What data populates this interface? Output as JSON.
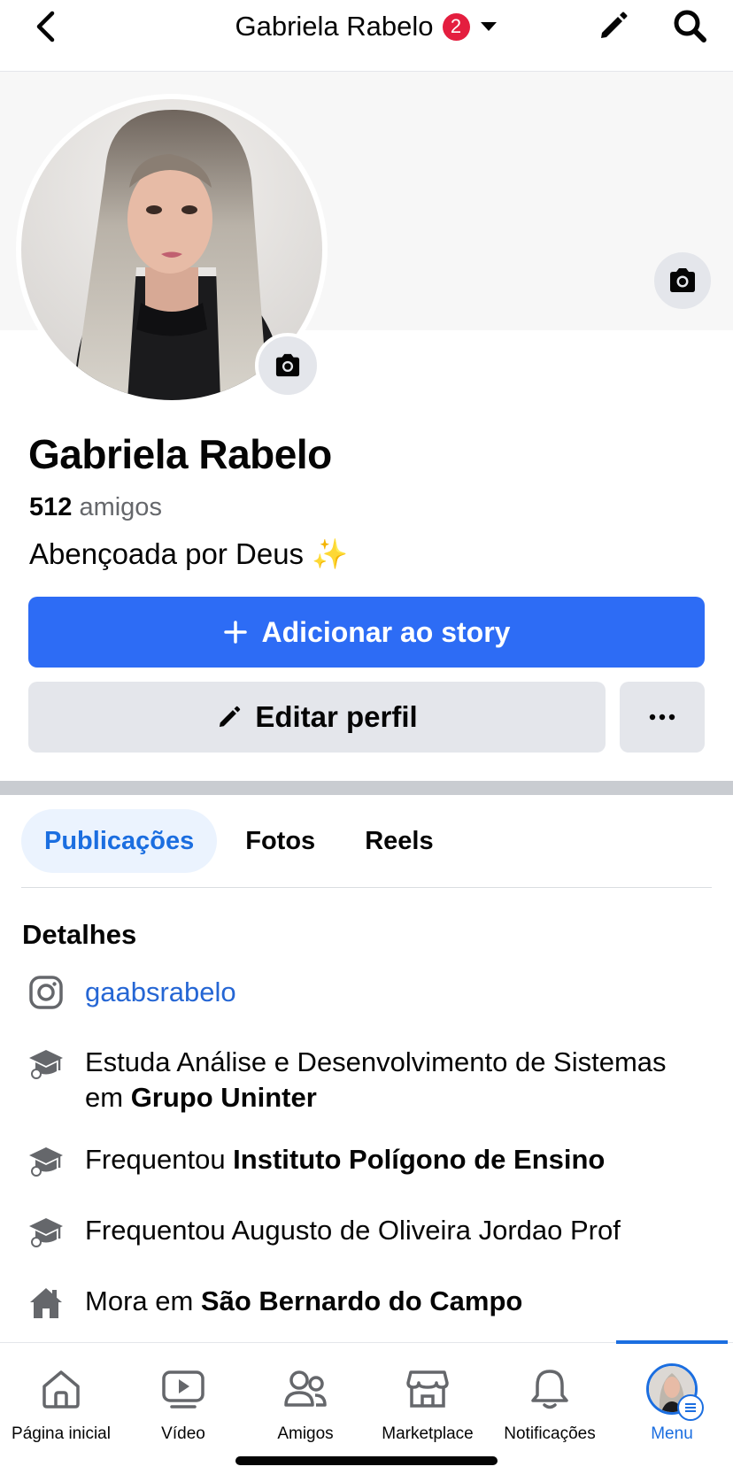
{
  "header": {
    "title": "Gabriela Rabelo",
    "badge_count": "2"
  },
  "profile": {
    "name": "Gabriela Rabelo",
    "friends_count": "512",
    "friends_label": "amigos",
    "bio": "Abençoada por Deus ✨"
  },
  "actions": {
    "story_label": "Adicionar ao story",
    "edit_label": "Editar perfil"
  },
  "tabs": [
    {
      "label": "Publicações",
      "active": true
    },
    {
      "label": "Fotos",
      "active": false
    },
    {
      "label": "Reels",
      "active": false
    }
  ],
  "details": {
    "title": "Detalhes",
    "instagram": "gaabsrabelo",
    "items": [
      {
        "prefix": "Estuda Análise e Desenvolvimento de Sistemas em ",
        "bold": "Grupo Uninter",
        "icon": "graduation-cap-icon"
      },
      {
        "prefix": "Frequentou ",
        "bold": "Instituto Polígono de Ensino",
        "icon": "graduation-cap-icon"
      },
      {
        "prefix": "Frequentou Augusto de Oliveira Jordao Prof",
        "bold": "",
        "icon": "graduation-cap-icon"
      },
      {
        "prefix": "Mora em ",
        "bold": "São Bernardo do Campo",
        "icon": "home-icon"
      }
    ]
  },
  "bottom_nav": [
    {
      "label": "Página inicial",
      "icon": "home-icon"
    },
    {
      "label": "Vídeo",
      "icon": "video-icon"
    },
    {
      "label": "Amigos",
      "icon": "friends-icon"
    },
    {
      "label": "Marketplace",
      "icon": "marketplace-icon"
    },
    {
      "label": "Notificações",
      "icon": "bell-icon"
    },
    {
      "label": "Menu",
      "icon": "avatar-menu",
      "active": true
    }
  ],
  "colors": {
    "accent": "#1b6ee0",
    "story_button": "#2d6cf5",
    "badge": "#e41e3f",
    "secondary_button": "#e4e6eb"
  }
}
